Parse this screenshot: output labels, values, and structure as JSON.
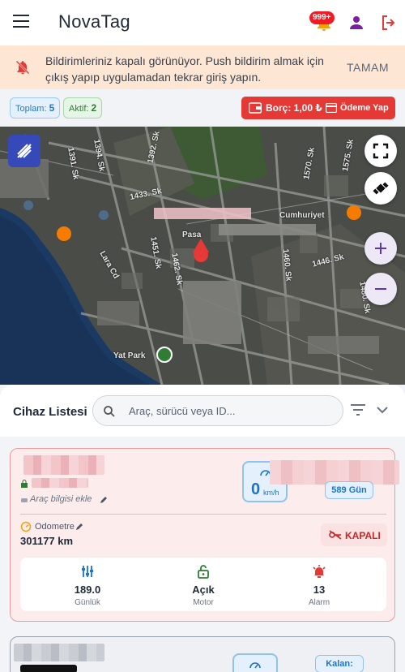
{
  "header": {
    "brand": "NovaTag",
    "notification_count": "999+"
  },
  "notice": {
    "message": "Bildirimleriniz kapalı görünüyor. Push bildirim almak için çıkış yapıp uygulamadan tekrar giriş yapın.",
    "ok_label": "TAMAM"
  },
  "stats": {
    "total_label": "Toplam:",
    "total_value": "5",
    "active_label": "Aktif:",
    "active_value": "2",
    "debt_label": "Borç: 1,00 ₺",
    "pay_label": "Ödeme Yap"
  },
  "map": {
    "labels": [
      "1433. Sk",
      "1446. Sk",
      "1451. Sk",
      "1460. Sk",
      "1570. Sk",
      "1575. Sk",
      "1394. Sk",
      "1391. Sk",
      "1392. Sk",
      "1462. Sk",
      "1480. Sk",
      "Lara Cd",
      "Pasa",
      "Cumhuriyet",
      "Yat Park"
    ]
  },
  "device_list": {
    "title": "Cihaz Listesi",
    "search_placeholder": "Araç, sürücü veya ID...",
    "cards": [
      {
        "vehicle_info": "Araç bilgisi ekle",
        "speed": "0",
        "speed_unit": "km/h",
        "days": "589 Gün",
        "odometer_label": "Odometre",
        "odometer_value": "301177 km",
        "ignition_label": "KAPALI",
        "stats": [
          {
            "value": "189.0",
            "label": "Günlük"
          },
          {
            "value": "Açık",
            "label": "Motor"
          },
          {
            "value": "13",
            "label": "Alarm"
          }
        ]
      },
      {
        "days": "Kalan:"
      }
    ]
  }
}
